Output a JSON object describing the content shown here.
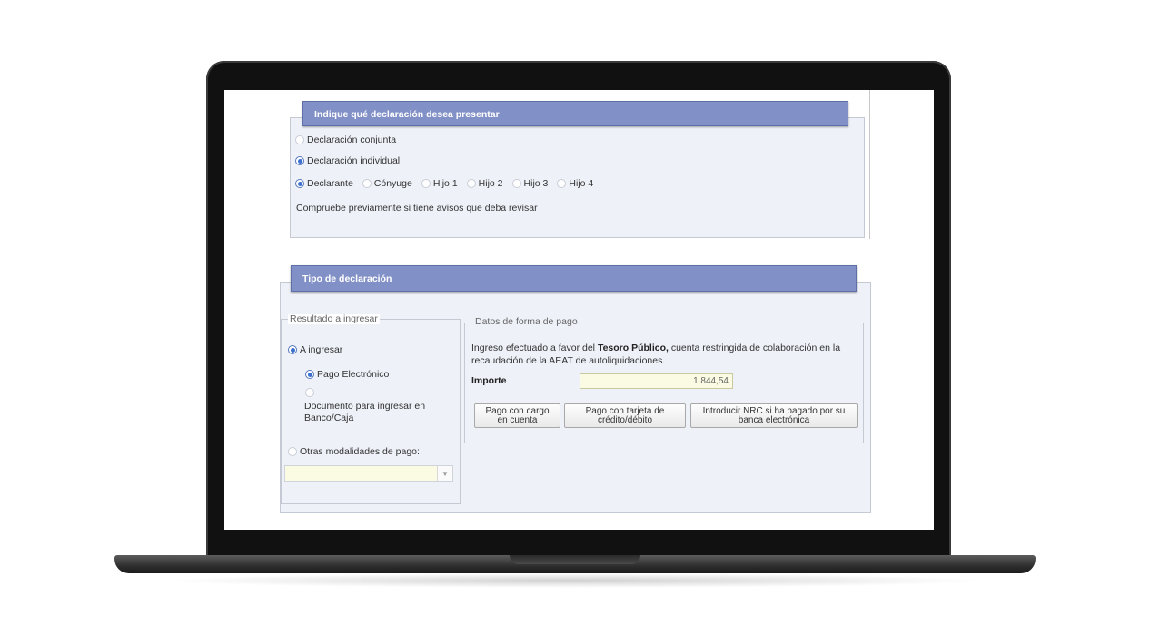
{
  "declaracion_panel": {
    "header": "Indique qué declaración desea presentar",
    "options": [
      {
        "label": "Declaración conjunta",
        "selected": false
      },
      {
        "label": "Declaración individual",
        "selected": true
      }
    ],
    "persons": [
      {
        "label": "Declarante",
        "selected": true
      },
      {
        "label": "Cónyuge",
        "selected": false
      },
      {
        "label": "Hijo 1",
        "selected": false
      },
      {
        "label": "Hijo 2",
        "selected": false
      },
      {
        "label": "Hijo 3",
        "selected": false
      },
      {
        "label": "Hijo 4",
        "selected": false
      }
    ],
    "notice": "Compruebe previamente si tiene avisos que deba revisar"
  },
  "tipo_panel": {
    "header": "Tipo de declaración",
    "resultado": {
      "legend": "Resultado a ingresar",
      "a_ingresar": "A ingresar",
      "pago_electronico": "Pago Electrónico",
      "documento": "Documento para ingresar en Banco/Caja",
      "otras": "Otras modalidades de pago:",
      "otras_select_value": ""
    },
    "forma_pago": {
      "legend": "Datos de forma de pago",
      "text_before": "Ingreso efectuado a favor del ",
      "text_bold": "Tesoro Público,",
      "text_after": " cuenta restringida de colaboración en la recaudación de la AEAT de autoliquidaciones.",
      "importe_label": "Importe",
      "importe_value": "1.844,54",
      "buttons": [
        "Pago con cargo\nen cuenta",
        "Pago con tarjeta de\ncrédito/débito",
        "Introducir NRC si ha pagado por su\nbanca electrónica"
      ]
    }
  },
  "colors": {
    "header_bg": "#8190c6",
    "panel_bg": "#eef1f8",
    "field_bg": "#fbfbe3",
    "radio_selected": "#3b6fd0"
  }
}
